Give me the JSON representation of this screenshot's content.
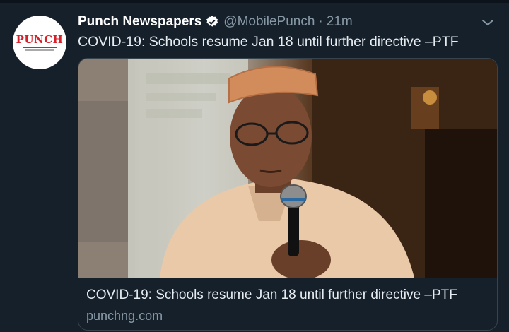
{
  "account": {
    "name": "Punch Newspapers",
    "handle": "@MobilePunch",
    "separator": "·",
    "time": "21m",
    "avatar_logo": "PUNCH",
    "verified_icon": "verified-badge-icon"
  },
  "tweet": {
    "text": "COVID-19: Schools resume Jan 18 until further directive –PTF"
  },
  "card": {
    "title": "COVID-19: Schools resume Jan 18 until further directive –PTF",
    "domain": "punchng.com"
  },
  "colors": {
    "background": "#15202b",
    "secondary_text": "#8899a6",
    "border": "#38444d",
    "verified": "#ffffff",
    "brand_red": "#d6202a"
  },
  "icons": {
    "menu": "chevron-down-icon"
  }
}
